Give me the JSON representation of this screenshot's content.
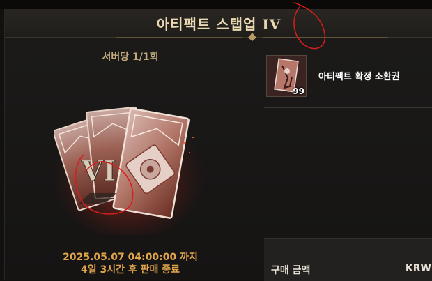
{
  "header": {
    "title": "아티팩트 스탭업 IV"
  },
  "product": {
    "purchase_limit": "서버당 1/1회",
    "card_numeral": "VI",
    "sale_end": "2025.05.07 04:00:00 까지",
    "remaining": "4일 3시간 후 판매 종료"
  },
  "rewards": [
    {
      "name": "아티팩트 확정 소환권",
      "count": "99"
    }
  ],
  "price": {
    "label": "구매 금액",
    "currency": "KRW"
  },
  "colors": {
    "accent_gold": "#e2a54c",
    "title": "#e9d8b2",
    "annotation": "#d41e1e"
  }
}
